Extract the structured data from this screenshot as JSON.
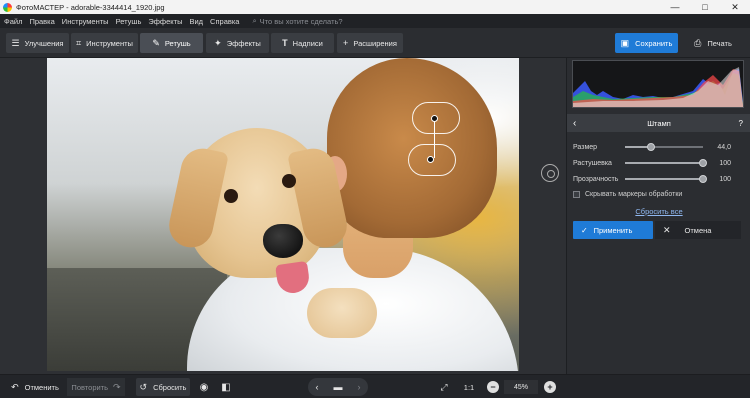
{
  "window": {
    "title": "ФотоМАСТЕР - adorable-3344414_1920.jpg",
    "minimize": "—",
    "maximize": "□",
    "close": "✕"
  },
  "menu": {
    "items": [
      "Файл",
      "Правка",
      "Инструменты",
      "Ретушь",
      "Эффекты",
      "Вид",
      "Справка"
    ],
    "search_placeholder": "Что вы хотите сделать?"
  },
  "toolbar": {
    "tabs": [
      {
        "label": "Улучшения",
        "icon": "sliders-icon",
        "active": false
      },
      {
        "label": "Инструменты",
        "icon": "crop-icon",
        "active": false
      },
      {
        "label": "Ретушь",
        "icon": "brush-icon",
        "active": true
      },
      {
        "label": "Эффекты",
        "icon": "magic-wand-icon",
        "active": false
      },
      {
        "label": "Надписи",
        "icon": "text-icon",
        "active": false
      },
      {
        "label": "Расширения",
        "icon": "plus-icon",
        "active": false
      }
    ],
    "save_label": "Сохранить",
    "print_label": "Печать"
  },
  "panel": {
    "title": "Штамп",
    "help": "?",
    "sliders": [
      {
        "label": "Размер",
        "value": "44,0",
        "fraction": 0.33
      },
      {
        "label": "Растушевка",
        "value": "100",
        "fraction": 1.0
      },
      {
        "label": "Прозрачность",
        "value": "100",
        "fraction": 1.0
      }
    ],
    "hide_markers_label": "Скрывать маркеры обработки",
    "hide_markers_checked": false,
    "reset_all": "Сбросить все",
    "apply_label": "Применить",
    "cancel_label": "Отмена"
  },
  "bottombar": {
    "undo_label": "Отменить",
    "redo_label": "Повторить",
    "reset_label": "Сбросить",
    "ratio_label": "1:1",
    "zoom_value": "45%"
  },
  "colors": {
    "accent": "#1f7bd7",
    "background": "#2b2d31"
  }
}
